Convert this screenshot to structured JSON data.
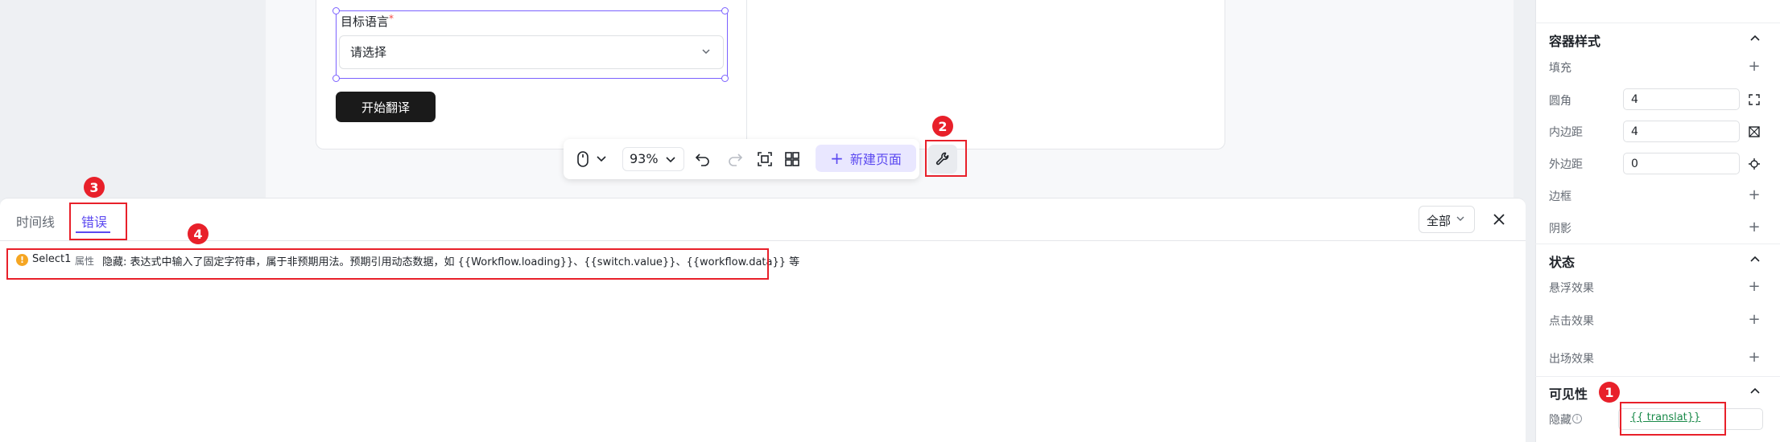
{
  "form": {
    "field_label": "目标语言",
    "required_mark": "*",
    "select_placeholder": "请选择",
    "start_button": "开始翻译"
  },
  "toolbar": {
    "zoom": "93%",
    "new_page": "新建页面",
    "new_page_plus": "+"
  },
  "panel": {
    "tabs": [
      {
        "label": "时间线",
        "active": false
      },
      {
        "label": "错误",
        "active": true
      }
    ],
    "filter": "全部",
    "errors": [
      {
        "severity_icon": "!",
        "component": "Select1",
        "type": "属性",
        "message": "隐藏: 表达式中输入了固定字符串，属于非预期用法。预期引用动态数据，如 {{Workflow.loading}}、{{switch.value}}、{{workflow.data}} 等"
      }
    ]
  },
  "sidebar": {
    "container_style": {
      "title": "容器样式",
      "fill": "填充",
      "radius_label": "圆角",
      "radius_value": "4",
      "padding_label": "内边距",
      "padding_value": "4",
      "margin_label": "外边距",
      "margin_value": "0",
      "border": "边框",
      "shadow": "阴影"
    },
    "state": {
      "title": "状态",
      "hover": "悬浮效果",
      "click": "点击效果",
      "appear": "出场效果"
    },
    "visibility": {
      "title": "可见性",
      "hidden_label": "隐藏",
      "hidden_value": "{{ translat}}"
    }
  },
  "annotations": [
    "1",
    "2",
    "3",
    "4"
  ],
  "colors": {
    "accent": "#5b49f0",
    "annotation": "#e8202a",
    "warning": "#f5a623",
    "expression": "#1a8a4a"
  }
}
